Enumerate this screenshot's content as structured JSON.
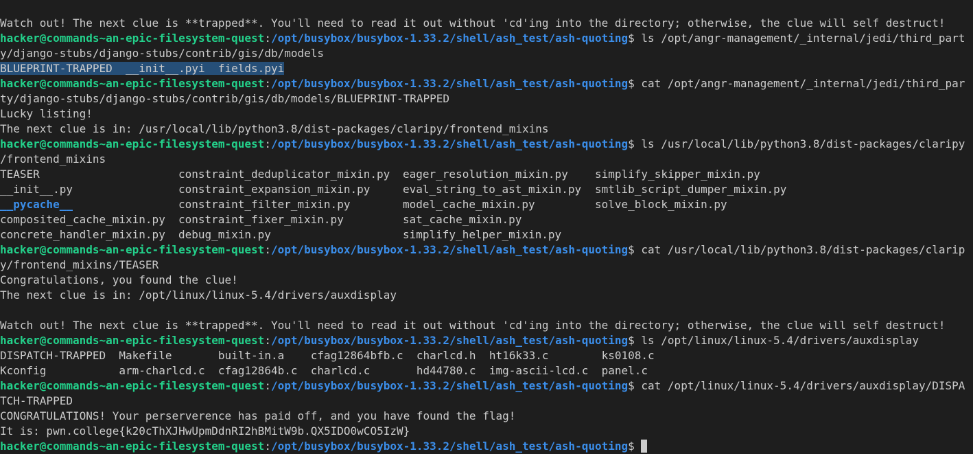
{
  "prompt": {
    "user_host": "hacker@commands~an-epic-filesystem-quest",
    "separator": ":",
    "cwd": "/opt/busybox/busybox-1.33.2/shell/ash_test/ash-quoting",
    "symbol": "$ "
  },
  "colors": {
    "background": "#1e1e1e",
    "text": "#cccccc",
    "user_host": "#23d18b",
    "path": "#3b8eea",
    "selection": "#264f78"
  },
  "lines": [
    {
      "type": "text",
      "text": "Watch out! The next clue is **trapped**. You'll need to read it out without 'cd'ing into the directory; otherwise, the clue will self destruct!"
    },
    {
      "type": "prompt",
      "cmd": "ls /opt/angr-management/_internal/jedi/third_part"
    },
    {
      "type": "text",
      "text": "y/django-stubs/django-stubs/contrib/gis/db/models"
    },
    {
      "type": "selected",
      "text": "BLUEPRINT-TRAPPED  __init__.pyi  fields.pyi"
    },
    {
      "type": "prompt",
      "cmd": "cat /opt/angr-management/_internal/jedi/third_par"
    },
    {
      "type": "text",
      "text": "ty/django-stubs/django-stubs/contrib/gis/db/models/BLUEPRINT-TRAPPED"
    },
    {
      "type": "text",
      "text": "Lucky listing!"
    },
    {
      "type": "text",
      "text": "The next clue is in: /usr/local/lib/python3.8/dist-packages/claripy/frontend_mixins"
    },
    {
      "type": "prompt",
      "cmd": "ls /usr/local/lib/python3.8/dist-packages/claripy"
    },
    {
      "type": "text",
      "text": "/frontend_mixins"
    },
    {
      "type": "cols",
      "cells": [
        {
          "text": "TEASER",
          "dir": false
        },
        {
          "text": "constraint_deduplicator_mixin.py",
          "dir": false
        },
        {
          "text": "eager_resolution_mixin.py",
          "dir": false
        },
        {
          "text": "simplify_skipper_mixin.py",
          "dir": false
        }
      ]
    },
    {
      "type": "cols",
      "cells": [
        {
          "text": "__init__.py",
          "dir": false
        },
        {
          "text": "constraint_expansion_mixin.py",
          "dir": false
        },
        {
          "text": "eval_string_to_ast_mixin.py",
          "dir": false
        },
        {
          "text": "smtlib_script_dumper_mixin.py",
          "dir": false
        }
      ]
    },
    {
      "type": "cols",
      "cells": [
        {
          "text": "__pycache__",
          "dir": true
        },
        {
          "text": "constraint_filter_mixin.py",
          "dir": false
        },
        {
          "text": "model_cache_mixin.py",
          "dir": false
        },
        {
          "text": "solve_block_mixin.py",
          "dir": false
        }
      ]
    },
    {
      "type": "cols",
      "cells": [
        {
          "text": "composited_cache_mixin.py",
          "dir": false
        },
        {
          "text": "constraint_fixer_mixin.py",
          "dir": false
        },
        {
          "text": "sat_cache_mixin.py",
          "dir": false
        },
        {
          "text": "",
          "dir": false
        }
      ]
    },
    {
      "type": "cols",
      "cells": [
        {
          "text": "concrete_handler_mixin.py",
          "dir": false
        },
        {
          "text": "debug_mixin.py",
          "dir": false
        },
        {
          "text": "simplify_helper_mixin.py",
          "dir": false
        },
        {
          "text": "",
          "dir": false
        }
      ]
    },
    {
      "type": "prompt",
      "cmd": "cat /usr/local/lib/python3.8/dist-packages/clarip"
    },
    {
      "type": "text",
      "text": "y/frontend_mixins/TEASER"
    },
    {
      "type": "text",
      "text": "Congratulations, you found the clue!"
    },
    {
      "type": "text",
      "text": "The next clue is in: /opt/linux/linux-5.4/drivers/auxdisplay"
    },
    {
      "type": "text",
      "text": ""
    },
    {
      "type": "text",
      "text": "Watch out! The next clue is **trapped**. You'll need to read it out without 'cd'ing into the directory; otherwise, the clue will self destruct!"
    },
    {
      "type": "prompt",
      "cmd": "ls /opt/linux/linux-5.4/drivers/auxdisplay"
    },
    {
      "type": "text",
      "text": "DISPATCH-TRAPPED  Makefile       built-in.a    cfag12864bfb.c  charlcd.h  ht16k33.c        ks0108.c"
    },
    {
      "type": "text",
      "text": "Kconfig           arm-charlcd.c  cfag12864b.c  charlcd.c       hd44780.c  img-ascii-lcd.c  panel.c"
    },
    {
      "type": "prompt",
      "cmd": "cat /opt/linux/linux-5.4/drivers/auxdisplay/DISPA"
    },
    {
      "type": "text",
      "text": "TCH-TRAPPED"
    },
    {
      "type": "text",
      "text": "CONGRATULATIONS! Your perserverence has paid off, and you have found the flag!"
    },
    {
      "type": "text",
      "text": "It is: pwn.college{k20cThXJHwUpmDdnRI2hBMitW9b.QX5IDO0wCO5IzW}"
    },
    {
      "type": "prompt",
      "cmd": "",
      "cursor": true
    }
  ]
}
